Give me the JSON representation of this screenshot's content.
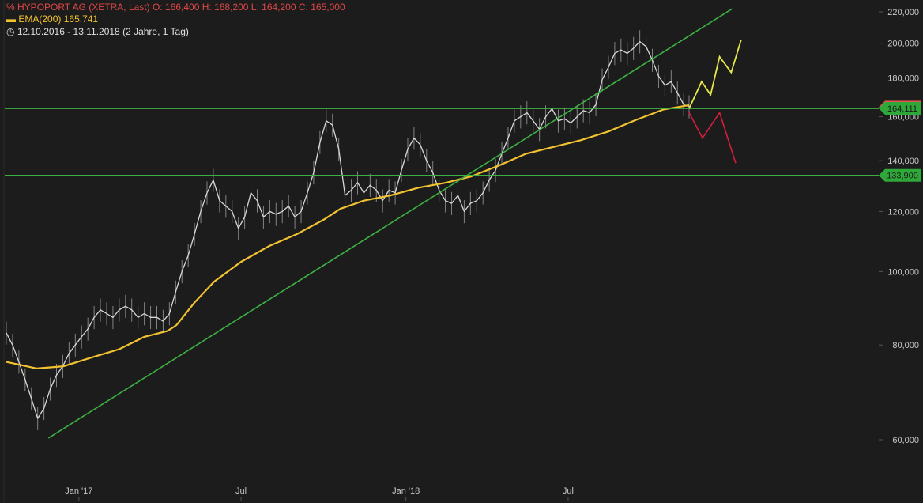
{
  "header": {
    "title_line": "HYPOPORT AG (XETRA, Last)",
    "ohlc": {
      "o_label": "O:",
      "o": "166,400",
      "h_label": "H:",
      "h": "168,200",
      "l_label": "L:",
      "l": "164,200",
      "c_label": "C:",
      "c": "165,000"
    },
    "ema_label": "EMA(200)",
    "ema_value": "165,741",
    "range_label": "12.10.2016 - 13.11.2018",
    "range_detail": "(2 Jahre, 1 Tag)",
    "icons": {
      "chart_icon": "percent-chart-icon",
      "ema_icon": "line-legend-icon",
      "clock_icon": "clock-icon"
    }
  },
  "colors": {
    "background": "#1c1c1c",
    "price": "#d8d8d8",
    "ema": "#f2c230",
    "support": "#3cb043",
    "bullish": "#e8e84a",
    "bearish": "#d81e3c",
    "badge_red": "#e05050",
    "badge_green": "#2fa83a"
  },
  "chart_data": {
    "type": "line",
    "scale": "log",
    "x_start": "2016-10-12",
    "x_end": "2018-11-13",
    "ylim": [
      54000,
      232000
    ],
    "y_ticks": [
      60000,
      80000,
      100000,
      120000,
      140000,
      160000,
      180000,
      200000,
      220000
    ],
    "y_tick_labels": [
      "60,000",
      "80,000",
      "100,000",
      "120,000",
      "140,000",
      "160,000",
      "180,000",
      "200,000",
      "220,000"
    ],
    "x_ticks": [
      "2017-01-01",
      "2017-07-01",
      "2018-01-01",
      "2018-07-01"
    ],
    "x_tick_labels": [
      "Jan '17",
      "Jul",
      "Jan '18",
      "Jul"
    ],
    "series": [
      {
        "name": "HYPOPORT AG",
        "x": [
          "2016-10-12",
          "2016-10-19",
          "2016-10-26",
          "2016-11-02",
          "2016-11-09",
          "2016-11-16",
          "2016-11-23",
          "2016-11-30",
          "2016-12-07",
          "2016-12-14",
          "2016-12-21",
          "2016-12-28",
          "2017-01-04",
          "2017-01-11",
          "2017-01-18",
          "2017-01-25",
          "2017-02-01",
          "2017-02-08",
          "2017-02-15",
          "2017-02-22",
          "2017-03-01",
          "2017-03-08",
          "2017-03-15",
          "2017-03-22",
          "2017-03-29",
          "2017-04-05",
          "2017-04-12",
          "2017-04-19",
          "2017-04-26",
          "2017-05-03",
          "2017-05-10",
          "2017-05-17",
          "2017-05-24",
          "2017-05-31",
          "2017-06-07",
          "2017-06-14",
          "2017-06-21",
          "2017-06-28",
          "2017-07-05",
          "2017-07-12",
          "2017-07-19",
          "2017-07-26",
          "2017-08-02",
          "2017-08-09",
          "2017-08-16",
          "2017-08-23",
          "2017-08-30",
          "2017-09-06",
          "2017-09-13",
          "2017-09-20",
          "2017-09-27",
          "2017-10-04",
          "2017-10-11",
          "2017-10-18",
          "2017-10-25",
          "2017-11-01",
          "2017-11-08",
          "2017-11-15",
          "2017-11-22",
          "2017-11-29",
          "2017-12-06",
          "2017-12-13",
          "2017-12-20",
          "2017-12-27",
          "2018-01-03",
          "2018-01-10",
          "2018-01-17",
          "2018-01-24",
          "2018-01-31",
          "2018-02-07",
          "2018-02-14",
          "2018-02-21",
          "2018-02-28",
          "2018-03-07",
          "2018-03-14",
          "2018-03-21",
          "2018-03-28",
          "2018-04-04",
          "2018-04-11",
          "2018-04-18",
          "2018-04-25",
          "2018-05-02",
          "2018-05-09",
          "2018-05-16",
          "2018-05-23",
          "2018-05-30",
          "2018-06-06",
          "2018-06-13",
          "2018-06-20",
          "2018-06-27",
          "2018-07-04",
          "2018-07-11",
          "2018-07-18",
          "2018-07-25",
          "2018-08-01",
          "2018-08-08",
          "2018-08-15",
          "2018-08-22",
          "2018-08-29",
          "2018-09-05",
          "2018-09-12",
          "2018-09-19",
          "2018-09-26",
          "2018-10-03",
          "2018-10-10",
          "2018-10-17",
          "2018-10-24",
          "2018-10-31",
          "2018-11-07",
          "2018-11-13"
        ],
        "values": [
          83000,
          80000,
          76000,
          72000,
          68000,
          64000,
          66000,
          70000,
          73000,
          75000,
          78000,
          80000,
          82000,
          84000,
          87000,
          89000,
          88000,
          87000,
          89000,
          90000,
          89000,
          87000,
          88000,
          87000,
          87000,
          86000,
          88000,
          94000,
          100000,
          105000,
          112000,
          120000,
          127000,
          132000,
          124000,
          122000,
          120000,
          114000,
          118000,
          127000,
          124000,
          118000,
          120000,
          119000,
          120000,
          122000,
          118000,
          120000,
          127000,
          135000,
          148000,
          158000,
          156000,
          145000,
          126000,
          128000,
          131000,
          127000,
          130000,
          128000,
          124000,
          128000,
          127000,
          136000,
          145000,
          150000,
          147000,
          140000,
          135000,
          128000,
          124000,
          123000,
          126000,
          120000,
          123000,
          124000,
          127000,
          132000,
          136000,
          143000,
          150000,
          158000,
          160000,
          162000,
          158000,
          154000,
          160000,
          164000,
          158000,
          159000,
          157000,
          160000,
          163000,
          162000,
          166000,
          179000,
          186000,
          194000,
          196000,
          194000,
          197000,
          201000,
          198000,
          190000,
          181000,
          176000,
          178000,
          172000,
          166000,
          165000
        ]
      },
      {
        "name": "EMA(200)",
        "x": [
          "2016-10-12",
          "2016-11-15",
          "2016-12-15",
          "2017-01-15",
          "2017-02-15",
          "2017-03-15",
          "2017-04-10",
          "2017-04-20",
          "2017-05-10",
          "2017-06-01",
          "2017-07-01",
          "2017-08-01",
          "2017-09-01",
          "2017-10-01",
          "2017-10-20",
          "2017-11-15",
          "2017-12-15",
          "2018-01-15",
          "2018-02-15",
          "2018-03-15",
          "2018-04-15",
          "2018-05-15",
          "2018-06-15",
          "2018-07-15",
          "2018-08-15",
          "2018-09-15",
          "2018-10-15",
          "2018-11-13"
        ],
        "values": [
          76000,
          74500,
          75000,
          77000,
          79000,
          82000,
          83500,
          85000,
          91000,
          97000,
          103000,
          108000,
          112000,
          117000,
          121000,
          124000,
          126000,
          129000,
          131000,
          133500,
          138000,
          143000,
          146000,
          149000,
          153000,
          158500,
          163500,
          165741
        ]
      }
    ],
    "annotations": {
      "support_levels": [
        {
          "value": 164111,
          "label": "164,111"
        },
        {
          "value": 133900,
          "label": "133,900"
        }
      ],
      "trendline": {
        "from": [
          "2016-11-28",
          60300
        ],
        "to": [
          "2018-12-31",
          222000
        ]
      },
      "bullish_path": {
        "x": [
          "2018-11-13",
          "2018-11-27",
          "2018-12-07",
          "2018-12-17",
          "2018-12-30",
          "2019-01-10"
        ],
        "y": [
          164000,
          178000,
          171000,
          192000,
          183000,
          202000
        ]
      },
      "bearish_path": {
        "x": [
          "2018-11-13",
          "2018-11-28",
          "2018-12-17",
          "2019-01-04"
        ],
        "y": [
          162000,
          150000,
          162000,
          139000
        ]
      }
    }
  }
}
